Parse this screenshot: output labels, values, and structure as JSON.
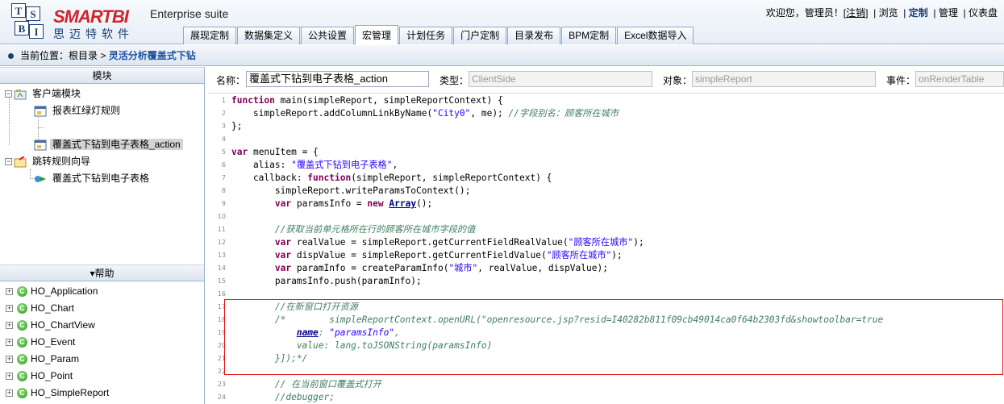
{
  "header": {
    "brand": "SMARTBI",
    "brand_cn": "思迈特软件",
    "suite": "Enterprise suite",
    "logo_letters": [
      "T",
      "S",
      "B",
      "I"
    ],
    "welcome": "欢迎您，管理员！[",
    "logout": "注销",
    "welcome_end": "]",
    "links": [
      "浏览",
      "定制",
      "管理",
      "仪表盘"
    ]
  },
  "tabs": [
    "展现定制",
    "数据集定义",
    "公共设置",
    "宏管理",
    "计划任务",
    "门户定制",
    "目录发布",
    "BPM定制",
    "Excel数据导入"
  ],
  "active_tab": "宏管理",
  "breadcrumb": {
    "prefix": "当前位置：",
    "root": "根目录 > ",
    "current": "灵活分析覆盖式下钻"
  },
  "left": {
    "module_head": "模块",
    "tree": {
      "client_module": "客户端模块",
      "rule1": "报表红绿灯规则",
      "rule2": "覆盖式下钻到电子表格_action",
      "jump_module": "跳转规则向导",
      "jump1": "覆盖式下钻到电子表格"
    },
    "help_head": "▾帮助",
    "help_items": [
      "HO_Application",
      "HO_Chart",
      "HO_ChartView",
      "HO_Event",
      "HO_Param",
      "HO_Point",
      "HO_SimpleReport"
    ]
  },
  "form": {
    "name_label": "名称：",
    "name_value": "覆盖式下钻到电子表格_action",
    "type_label": "类型：",
    "type_value": "ClientSide",
    "object_label": "对象：",
    "object_value": "simpleReport",
    "event_label": "事件：",
    "event_value": "onRenderTable"
  },
  "code_lines": [
    {
      "n": "1",
      "t": "function main(simpleReport, simpleReportContext) {"
    },
    {
      "n": "2",
      "t": "    simpleReport.addColumnLinkByName(\"City0\", me); //字段别名：顾客所在城市"
    },
    {
      "n": "3",
      "t": "};"
    },
    {
      "n": "4",
      "t": ""
    },
    {
      "n": "5",
      "t": "var menuItem = {"
    },
    {
      "n": "6",
      "t": "    alias: \"覆盖式下钻到电子表格\","
    },
    {
      "n": "7",
      "t": "    callback: function(simpleReport, simpleReportContext) {"
    },
    {
      "n": "8",
      "t": "        simpleReport.writeParamsToContext();"
    },
    {
      "n": "9",
      "t": "        var paramsInfo = new Array();"
    },
    {
      "n": "10",
      "t": ""
    },
    {
      "n": "11",
      "t": "        //获取当前单元格所在行的顾客所在城市字段的值"
    },
    {
      "n": "12",
      "t": "        var realValue = simpleReport.getCurrentFieldRealValue(\"顾客所在城市\");"
    },
    {
      "n": "13",
      "t": "        var dispValue = simpleReport.getCurrentFieldValue(\"顾客所在城市\");"
    },
    {
      "n": "14",
      "t": "        var paramInfo = createParamInfo(\"城市\", realValue, dispValue);"
    },
    {
      "n": "15",
      "t": "        paramsInfo.push(paramInfo);"
    },
    {
      "n": "16",
      "t": ""
    },
    {
      "n": "17",
      "t": "        //在新窗口打开资源"
    },
    {
      "n": "18",
      "t": "        /*        simpleReportContext.openURL(\"openresource.jsp?resid=I40282b811f09cb49014ca0f64b2303fd&showtoolbar=true"
    },
    {
      "n": "19",
      "t": "            name: \"paramsInfo\","
    },
    {
      "n": "20",
      "t": "            value: lang.toJSONString(paramsInfo)"
    },
    {
      "n": "21",
      "t": "        }]);*/"
    },
    {
      "n": "22",
      "t": ""
    },
    {
      "n": "23",
      "t": "        // 在当前窗口覆盖式打开"
    },
    {
      "n": "24",
      "t": "        //debugger;"
    }
  ],
  "colors": {
    "brand_red": "#d2232a",
    "brand_blue": "#1a3f72",
    "highlight_box": "#e01010"
  }
}
